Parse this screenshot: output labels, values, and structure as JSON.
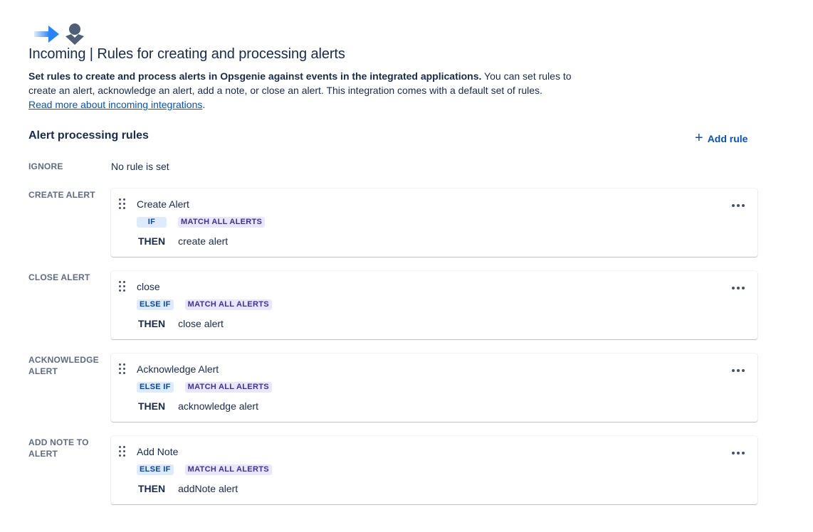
{
  "header": {
    "icons": [
      "arrow-right-icon",
      "user-icon"
    ],
    "title": "Incoming | Rules for creating and processing alerts"
  },
  "description": {
    "bold": "Set rules to create and process alerts in Opsgenie against events in the integrated applications.",
    "text": " You can set rules to create an alert, acknowledge an alert, add a note, or close an alert. This integration comes with a default set of rules.",
    "link": "Read more about incoming integrations",
    "trailing": "."
  },
  "section": {
    "title": "Alert processing rules",
    "add_rule": "Add rule"
  },
  "ignore": {
    "label": "IGNORE",
    "value": "No rule is set"
  },
  "groups": [
    {
      "label": "CREATE ALERT",
      "rule": {
        "name": "Create Alert",
        "condition": "IF",
        "match": "MATCH ALL ALERTS",
        "then": "THEN",
        "action": "create alert"
      }
    },
    {
      "label": "CLOSE ALERT",
      "rule": {
        "name": "close",
        "condition": "ELSE IF",
        "match": "MATCH ALL ALERTS",
        "then": "THEN",
        "action": "close alert"
      }
    },
    {
      "label": "ACKNOWLEDGE ALERT",
      "rule": {
        "name": "Acknowledge Alert",
        "condition": "ELSE IF",
        "match": "MATCH ALL ALERTS",
        "then": "THEN",
        "action": "acknowledge alert"
      }
    },
    {
      "label": "ADD NOTE TO ALERT",
      "rule": {
        "name": "Add Note",
        "condition": "ELSE IF",
        "match": "MATCH ALL ALERTS",
        "then": "THEN",
        "action": "addNote alert"
      }
    }
  ],
  "colors": {
    "accent": "#0052CC",
    "condition_chip_bg": "#DEEBFF",
    "match_chip_bg": "#EAE6FF"
  }
}
